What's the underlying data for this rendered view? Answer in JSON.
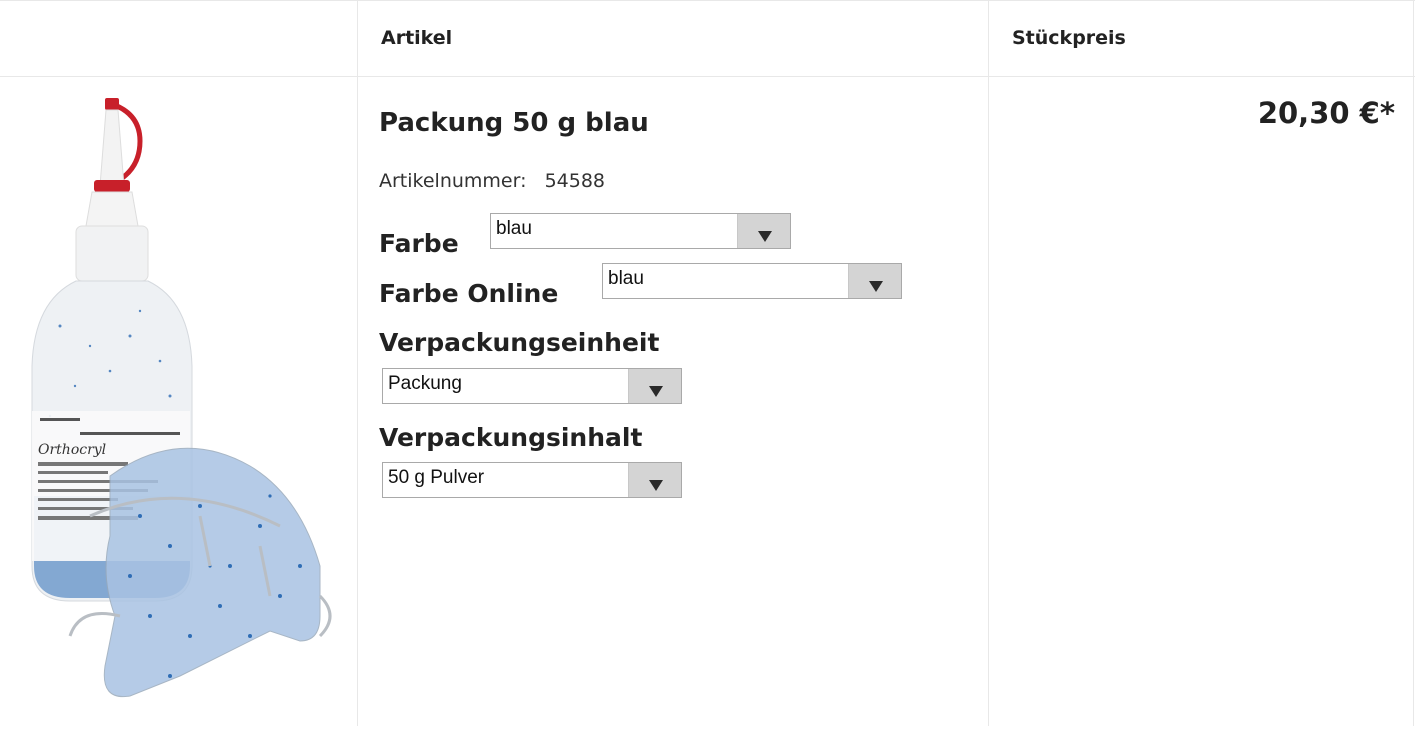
{
  "table": {
    "headers": {
      "image": "",
      "article": "Artikel",
      "unit_price": "Stückpreis"
    }
  },
  "product": {
    "image_icon": "orthocryl-disco-glitter-blue-bottle-with-retainer",
    "title": "Packung 50 g blau",
    "article_number_label": "Artikelnummer:",
    "article_number": "54588",
    "price": "20,30 €*",
    "options": [
      {
        "label": "Farbe",
        "selected": "blau"
      },
      {
        "label": "Farbe Online",
        "selected": "blau"
      },
      {
        "label": "Verpackungseinheit",
        "selected": "Packung"
      },
      {
        "label": "Verpackungsinhalt",
        "selected": "50 g Pulver"
      }
    ]
  },
  "colors": {
    "grid": "#e8e8e8",
    "glitter_blue": "#2f6db5",
    "cap_red": "#c8202a"
  }
}
